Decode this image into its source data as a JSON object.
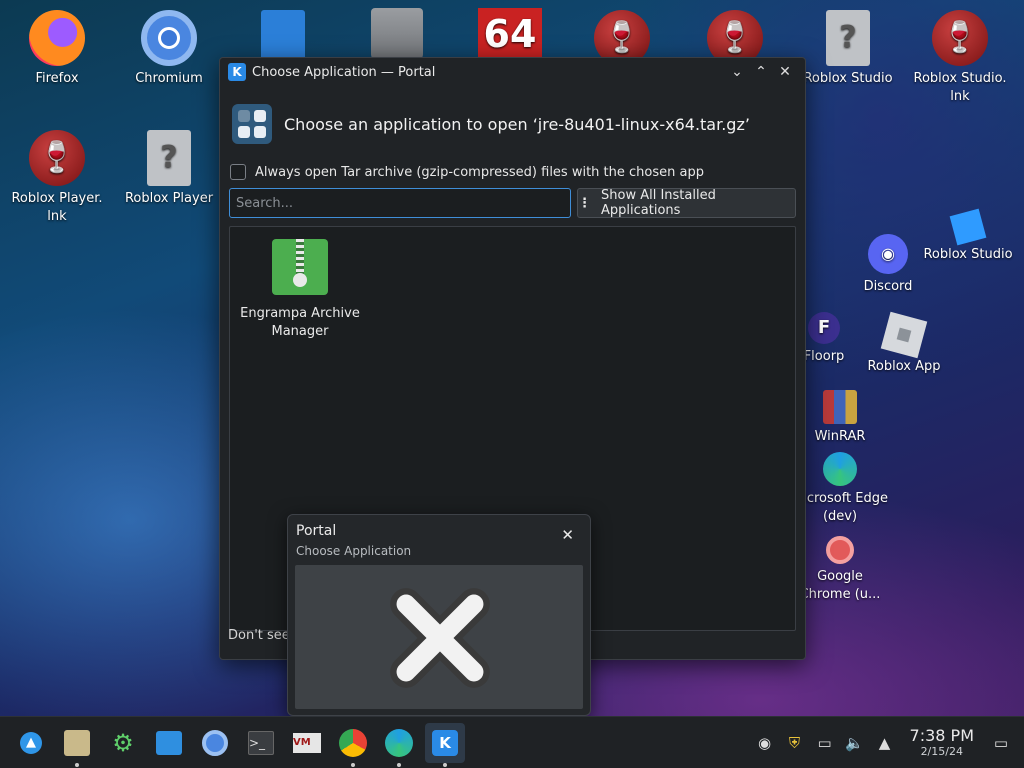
{
  "desktop": {
    "icons": [
      {
        "label": "Firefox"
      },
      {
        "label": "Chromium"
      },
      {
        "label": "Roblox Studio"
      },
      {
        "label": "Roblox Studio. lnk"
      },
      {
        "label": "Roblox Player. lnk"
      },
      {
        "label": "Roblox Player"
      },
      {
        "label": "Roblox Studio"
      },
      {
        "label": "Discord"
      },
      {
        "label": "Floorp"
      },
      {
        "label": "Roblox App"
      },
      {
        "label": "WinRAR"
      },
      {
        "label": "Microsoft Edge (dev)"
      },
      {
        "label": "Google Chrome (u..."
      }
    ],
    "wine_glyph": "🍷",
    "question_glyph": "?",
    "sixtyfour": "64"
  },
  "dialog": {
    "title": "Choose Application — Portal",
    "header": "Choose an application to open ‘jre-8u401-linux-x64.tar.gz’",
    "always_open_label": "Always open Tar archive (gzip-compressed) files with the chosen app",
    "search_placeholder": "Search...",
    "show_all_label": "Show All Installed Applications",
    "apps": [
      {
        "name": "Engrampa Archive Manager"
      }
    ],
    "footer_prefix": "Don't see the right app? Find",
    "footer_link": "..."
  },
  "notification": {
    "title": "Portal",
    "subtitle": "Choose Application",
    "close_glyph": "✕"
  },
  "taskbar": {
    "time": "7:38 PM",
    "date": "2/15/24"
  },
  "colors": {
    "accent": "#3daee9",
    "dialog_bg": "#202326",
    "taskbar_bg": "#1f2225"
  }
}
